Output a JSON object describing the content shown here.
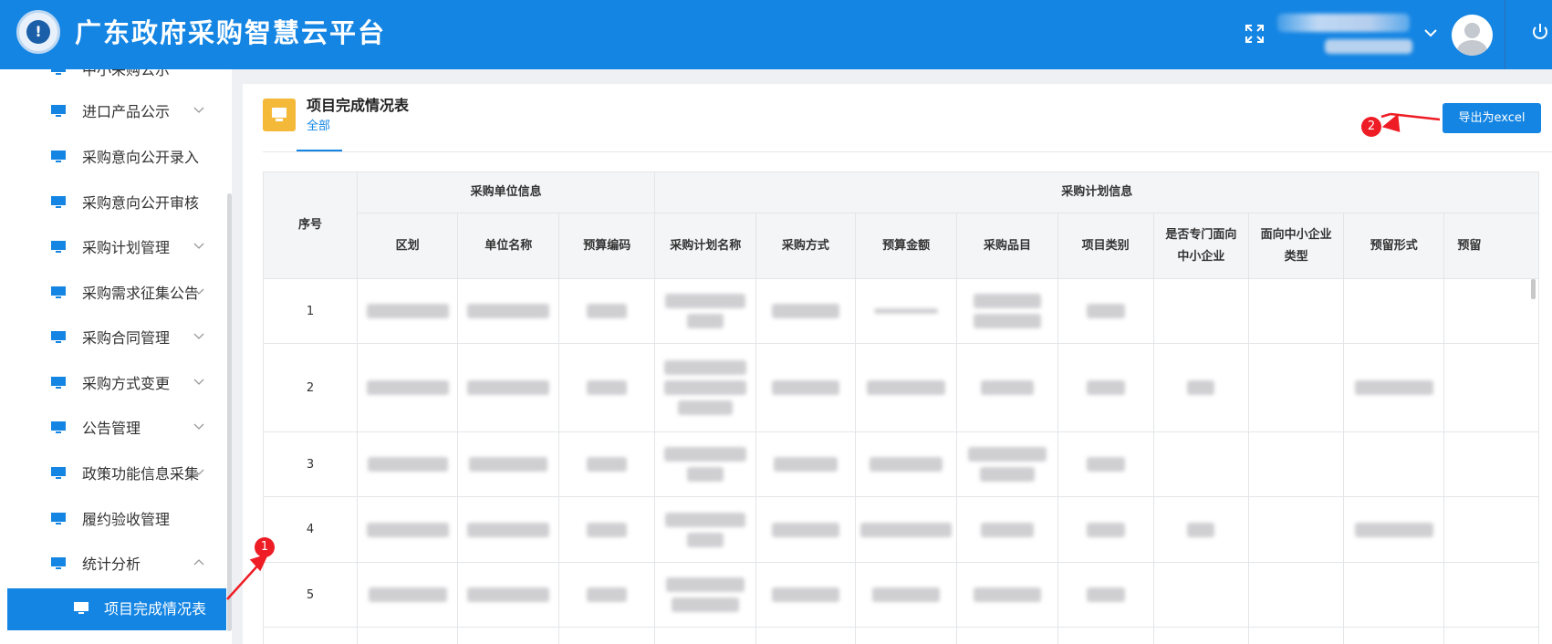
{
  "header": {
    "app_title": "广东政府采购智慧云平台",
    "icons": [
      "shield-logo",
      "fullscreen-icon",
      "chevron-down-icon",
      "avatar",
      "power-icon"
    ]
  },
  "sidebar": {
    "items": [
      {
        "label": "中小采购公示",
        "expandable": true,
        "partial": true
      },
      {
        "label": "进口产品公示",
        "expandable": true
      },
      {
        "label": "采购意向公开录入",
        "expandable": false
      },
      {
        "label": "采购意向公开审核",
        "expandable": false
      },
      {
        "label": "采购计划管理",
        "expandable": true
      },
      {
        "label": "采购需求征集公告",
        "expandable": true
      },
      {
        "label": "采购合同管理",
        "expandable": true
      },
      {
        "label": "采购方式变更",
        "expandable": true
      },
      {
        "label": "公告管理",
        "expandable": true
      },
      {
        "label": "政策功能信息采集",
        "expandable": true
      },
      {
        "label": "履约验收管理",
        "expandable": false
      },
      {
        "label": "统计分析",
        "expandable": true,
        "expanded": true
      }
    ],
    "active_subitem": {
      "label": "项目完成情况表"
    }
  },
  "content": {
    "title": "项目完成情况表",
    "tab": "全部",
    "export_label": "导出为excel"
  },
  "annotations": [
    {
      "number": "1"
    },
    {
      "number": "2"
    }
  ],
  "table": {
    "group_headers": {
      "seq": "序号",
      "unit_info": "采购单位信息",
      "plan_info": "采购计划信息"
    },
    "columns": [
      "区划",
      "单位名称",
      "预算编码",
      "采购计划名称",
      "采购方式",
      "预算金额",
      "采购品目",
      "项目类别",
      "是否专门面向中小企业",
      "面向中小企业类型",
      "预留形式",
      "预留"
    ],
    "rows": [
      {
        "seq": "1"
      },
      {
        "seq": "2"
      },
      {
        "seq": "3"
      },
      {
        "seq": "4"
      },
      {
        "seq": "5"
      },
      {
        "seq": ""
      }
    ]
  },
  "colors": {
    "primary": "#1485e3",
    "header_bg": "#1485e3",
    "accent_icon": "#f5b93a",
    "annotation_red": "#ee1c24"
  }
}
